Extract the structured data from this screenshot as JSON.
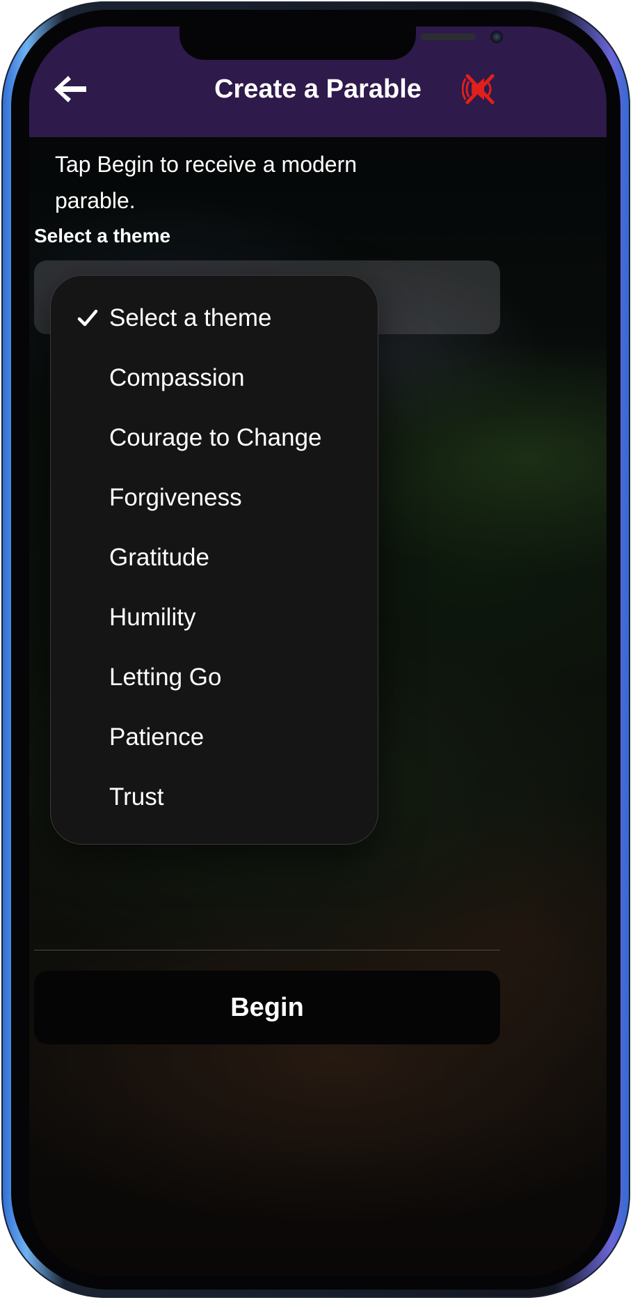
{
  "header": {
    "title": "Create a Parable",
    "back_icon": "arrow-left-icon",
    "sound_icon": "speaker-muted-icon",
    "background_color": "#2e1a4b",
    "mute_color": "#e0201a"
  },
  "intro_text": "Tap Begin to receive a modern parable.",
  "theme_picker": {
    "label": "Select a theme",
    "selected_value": "Select a theme",
    "options": [
      {
        "label": "Select a theme",
        "selected": true
      },
      {
        "label": "Compassion",
        "selected": false
      },
      {
        "label": "Courage to Change",
        "selected": false
      },
      {
        "label": "Forgiveness",
        "selected": false
      },
      {
        "label": "Gratitude",
        "selected": false
      },
      {
        "label": "Humility",
        "selected": false
      },
      {
        "label": "Letting Go",
        "selected": false
      },
      {
        "label": "Patience",
        "selected": false
      },
      {
        "label": "Trust",
        "selected": false
      }
    ]
  },
  "footer": {
    "begin_label": "Begin"
  }
}
